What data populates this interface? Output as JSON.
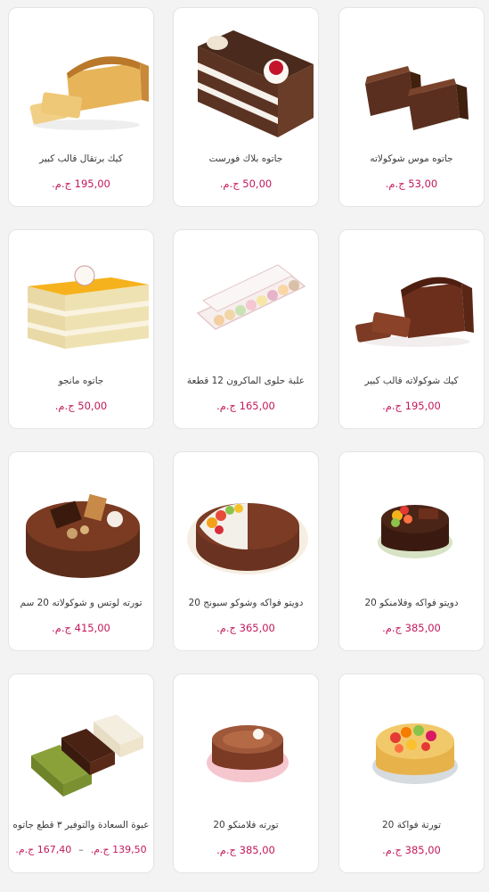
{
  "currency": "ج.م.",
  "products": [
    {
      "name": "كيك برتقال قالب كبير",
      "price": "195,00"
    },
    {
      "name": "جاتوه بلاك فورست",
      "price": "50,00"
    },
    {
      "name": "جاتوه موس شوكولاته",
      "price": "53,00"
    },
    {
      "name": "جاتوه مانجو",
      "price": "50,00"
    },
    {
      "name": "علبة حلوى الماكرون 12 قطعة",
      "price": "165,00"
    },
    {
      "name": "كيك شوكولاته قالب كبير",
      "price": "195,00"
    },
    {
      "name": "تورته لوتس و شوكولاته 20 سم",
      "price": "415,00"
    },
    {
      "name": "دويتو فواكه وشوكو سبونج 20",
      "price": "365,00"
    },
    {
      "name": "دويتو فواكه وفلامنكو 20",
      "price": "385,00"
    },
    {
      "name": "عبوة السعادة والتوفير ٣ قطع جاتوه",
      "price_min": "139,50",
      "price_max": "167,40",
      "range_sep": "–"
    },
    {
      "name": "تورته فلامنكو 20",
      "price": "385,00"
    },
    {
      "name": "تورتة فواكة 20",
      "price": "385,00"
    }
  ]
}
